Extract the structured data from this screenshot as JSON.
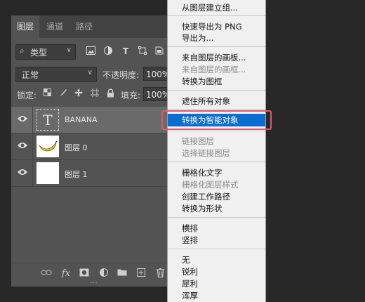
{
  "panel": {
    "tabs": [
      "图层",
      "通道",
      "路径"
    ],
    "filter": {
      "value": "类型",
      "icons": [
        "image-filter-icon",
        "adjustment-filter-icon",
        "type-filter-icon",
        "shape-filter-icon",
        "smart-object-filter-icon"
      ]
    },
    "blend_mode": "正常",
    "opacity_label": "不透明度:",
    "opacity_value": "100%",
    "lock_label": "锁定:",
    "fill_label": "填充:",
    "fill_value": "100%",
    "layers": [
      {
        "name": "BANANA",
        "thumb": "type",
        "thumb_glyph": "T",
        "selected": true,
        "visible": true
      },
      {
        "name": "图层 0",
        "thumb": "banana",
        "selected": false,
        "visible": true
      },
      {
        "name": "图层 1",
        "thumb": "white",
        "selected": false,
        "visible": true
      }
    ],
    "bottom_icons": [
      "link-icon",
      "fx-icon",
      "mask-icon",
      "adjustment-icon",
      "folder-icon",
      "new-layer-icon",
      "trash-icon"
    ],
    "fx_glyph": "fx"
  },
  "menu": {
    "items": [
      {
        "label": "从图层建立组...",
        "disabled": false
      },
      {
        "label": "快速导出为 PNG",
        "disabled": false
      },
      {
        "label": "导出为...",
        "disabled": false
      },
      {
        "label": "来自图层的画板...",
        "disabled": false
      },
      {
        "label": "来自图层的画框...",
        "disabled": true
      },
      {
        "label": "转换为图框",
        "disabled": false
      },
      {
        "label": "遮住所有对象",
        "disabled": false
      },
      {
        "label": "转换为智能对象",
        "disabled": false,
        "highlighted": true
      },
      {
        "label": "链接图层",
        "disabled": true
      },
      {
        "label": "选择链接图层",
        "disabled": true
      },
      {
        "label": "栅格化文字",
        "disabled": false
      },
      {
        "label": "栅格化图层样式",
        "disabled": true
      },
      {
        "label": "创建工作路径",
        "disabled": false
      },
      {
        "label": "转换为形状",
        "disabled": false
      },
      {
        "label": "横排",
        "disabled": false
      },
      {
        "label": "竖排",
        "disabled": false
      },
      {
        "label": "无",
        "disabled": false
      },
      {
        "label": "锐利",
        "disabled": false
      },
      {
        "label": "犀利",
        "disabled": false
      },
      {
        "label": "浑厚",
        "disabled": false
      }
    ],
    "highlight_color": "#0a6ed1"
  },
  "annotation": {
    "color": "#e05a6a"
  }
}
